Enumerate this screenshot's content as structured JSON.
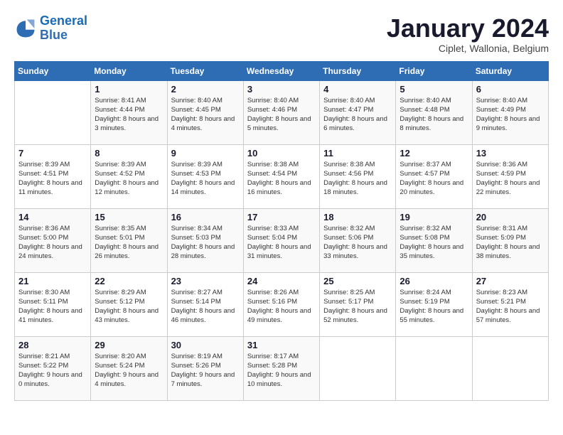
{
  "logo": {
    "line1": "General",
    "line2": "Blue"
  },
  "title": "January 2024",
  "location": "Ciplet, Wallonia, Belgium",
  "days_of_week": [
    "Sunday",
    "Monday",
    "Tuesday",
    "Wednesday",
    "Thursday",
    "Friday",
    "Saturday"
  ],
  "weeks": [
    [
      {
        "day": "",
        "sunrise": "",
        "sunset": "",
        "daylight": ""
      },
      {
        "day": "1",
        "sunrise": "Sunrise: 8:41 AM",
        "sunset": "Sunset: 4:44 PM",
        "daylight": "Daylight: 8 hours and 3 minutes."
      },
      {
        "day": "2",
        "sunrise": "Sunrise: 8:40 AM",
        "sunset": "Sunset: 4:45 PM",
        "daylight": "Daylight: 8 hours and 4 minutes."
      },
      {
        "day": "3",
        "sunrise": "Sunrise: 8:40 AM",
        "sunset": "Sunset: 4:46 PM",
        "daylight": "Daylight: 8 hours and 5 minutes."
      },
      {
        "day": "4",
        "sunrise": "Sunrise: 8:40 AM",
        "sunset": "Sunset: 4:47 PM",
        "daylight": "Daylight: 8 hours and 6 minutes."
      },
      {
        "day": "5",
        "sunrise": "Sunrise: 8:40 AM",
        "sunset": "Sunset: 4:48 PM",
        "daylight": "Daylight: 8 hours and 8 minutes."
      },
      {
        "day": "6",
        "sunrise": "Sunrise: 8:40 AM",
        "sunset": "Sunset: 4:49 PM",
        "daylight": "Daylight: 8 hours and 9 minutes."
      }
    ],
    [
      {
        "day": "7",
        "sunrise": "Sunrise: 8:39 AM",
        "sunset": "Sunset: 4:51 PM",
        "daylight": "Daylight: 8 hours and 11 minutes."
      },
      {
        "day": "8",
        "sunrise": "Sunrise: 8:39 AM",
        "sunset": "Sunset: 4:52 PM",
        "daylight": "Daylight: 8 hours and 12 minutes."
      },
      {
        "day": "9",
        "sunrise": "Sunrise: 8:39 AM",
        "sunset": "Sunset: 4:53 PM",
        "daylight": "Daylight: 8 hours and 14 minutes."
      },
      {
        "day": "10",
        "sunrise": "Sunrise: 8:38 AM",
        "sunset": "Sunset: 4:54 PM",
        "daylight": "Daylight: 8 hours and 16 minutes."
      },
      {
        "day": "11",
        "sunrise": "Sunrise: 8:38 AM",
        "sunset": "Sunset: 4:56 PM",
        "daylight": "Daylight: 8 hours and 18 minutes."
      },
      {
        "day": "12",
        "sunrise": "Sunrise: 8:37 AM",
        "sunset": "Sunset: 4:57 PM",
        "daylight": "Daylight: 8 hours and 20 minutes."
      },
      {
        "day": "13",
        "sunrise": "Sunrise: 8:36 AM",
        "sunset": "Sunset: 4:59 PM",
        "daylight": "Daylight: 8 hours and 22 minutes."
      }
    ],
    [
      {
        "day": "14",
        "sunrise": "Sunrise: 8:36 AM",
        "sunset": "Sunset: 5:00 PM",
        "daylight": "Daylight: 8 hours and 24 minutes."
      },
      {
        "day": "15",
        "sunrise": "Sunrise: 8:35 AM",
        "sunset": "Sunset: 5:01 PM",
        "daylight": "Daylight: 8 hours and 26 minutes."
      },
      {
        "day": "16",
        "sunrise": "Sunrise: 8:34 AM",
        "sunset": "Sunset: 5:03 PM",
        "daylight": "Daylight: 8 hours and 28 minutes."
      },
      {
        "day": "17",
        "sunrise": "Sunrise: 8:33 AM",
        "sunset": "Sunset: 5:04 PM",
        "daylight": "Daylight: 8 hours and 31 minutes."
      },
      {
        "day": "18",
        "sunrise": "Sunrise: 8:32 AM",
        "sunset": "Sunset: 5:06 PM",
        "daylight": "Daylight: 8 hours and 33 minutes."
      },
      {
        "day": "19",
        "sunrise": "Sunrise: 8:32 AM",
        "sunset": "Sunset: 5:08 PM",
        "daylight": "Daylight: 8 hours and 35 minutes."
      },
      {
        "day": "20",
        "sunrise": "Sunrise: 8:31 AM",
        "sunset": "Sunset: 5:09 PM",
        "daylight": "Daylight: 8 hours and 38 minutes."
      }
    ],
    [
      {
        "day": "21",
        "sunrise": "Sunrise: 8:30 AM",
        "sunset": "Sunset: 5:11 PM",
        "daylight": "Daylight: 8 hours and 41 minutes."
      },
      {
        "day": "22",
        "sunrise": "Sunrise: 8:29 AM",
        "sunset": "Sunset: 5:12 PM",
        "daylight": "Daylight: 8 hours and 43 minutes."
      },
      {
        "day": "23",
        "sunrise": "Sunrise: 8:27 AM",
        "sunset": "Sunset: 5:14 PM",
        "daylight": "Daylight: 8 hours and 46 minutes."
      },
      {
        "day": "24",
        "sunrise": "Sunrise: 8:26 AM",
        "sunset": "Sunset: 5:16 PM",
        "daylight": "Daylight: 8 hours and 49 minutes."
      },
      {
        "day": "25",
        "sunrise": "Sunrise: 8:25 AM",
        "sunset": "Sunset: 5:17 PM",
        "daylight": "Daylight: 8 hours and 52 minutes."
      },
      {
        "day": "26",
        "sunrise": "Sunrise: 8:24 AM",
        "sunset": "Sunset: 5:19 PM",
        "daylight": "Daylight: 8 hours and 55 minutes."
      },
      {
        "day": "27",
        "sunrise": "Sunrise: 8:23 AM",
        "sunset": "Sunset: 5:21 PM",
        "daylight": "Daylight: 8 hours and 57 minutes."
      }
    ],
    [
      {
        "day": "28",
        "sunrise": "Sunrise: 8:21 AM",
        "sunset": "Sunset: 5:22 PM",
        "daylight": "Daylight: 9 hours and 0 minutes."
      },
      {
        "day": "29",
        "sunrise": "Sunrise: 8:20 AM",
        "sunset": "Sunset: 5:24 PM",
        "daylight": "Daylight: 9 hours and 4 minutes."
      },
      {
        "day": "30",
        "sunrise": "Sunrise: 8:19 AM",
        "sunset": "Sunset: 5:26 PM",
        "daylight": "Daylight: 9 hours and 7 minutes."
      },
      {
        "day": "31",
        "sunrise": "Sunrise: 8:17 AM",
        "sunset": "Sunset: 5:28 PM",
        "daylight": "Daylight: 9 hours and 10 minutes."
      },
      {
        "day": "",
        "sunrise": "",
        "sunset": "",
        "daylight": ""
      },
      {
        "day": "",
        "sunrise": "",
        "sunset": "",
        "daylight": ""
      },
      {
        "day": "",
        "sunrise": "",
        "sunset": "",
        "daylight": ""
      }
    ]
  ]
}
